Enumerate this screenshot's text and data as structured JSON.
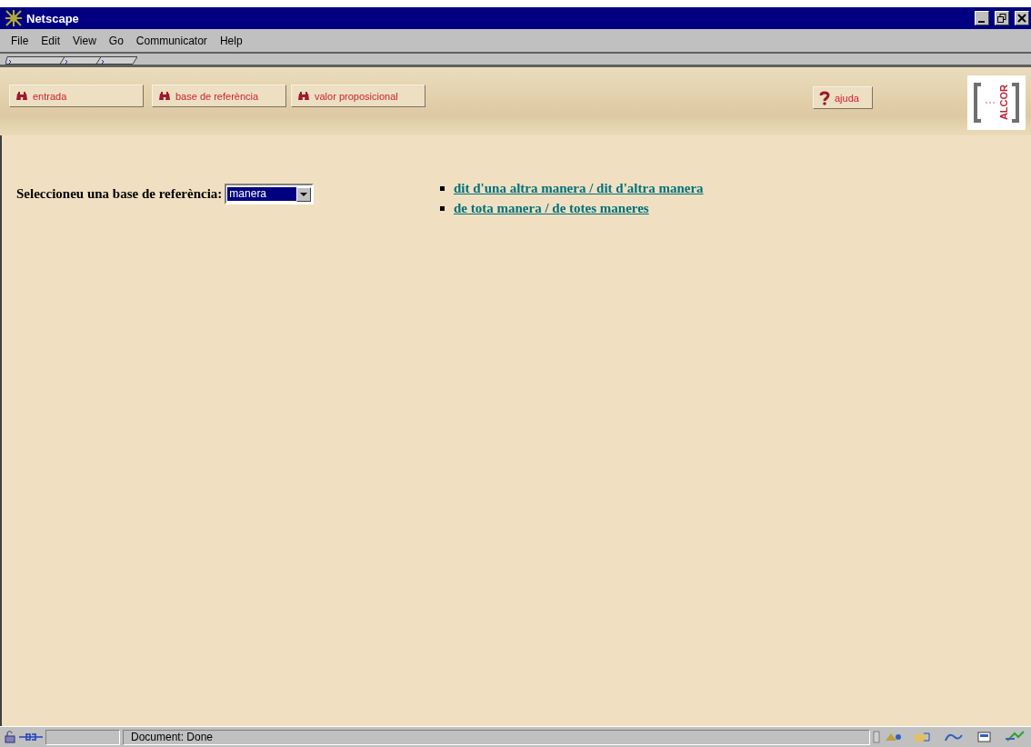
{
  "window": {
    "title": "Netscape"
  },
  "menu": [
    "File",
    "Edit",
    "View",
    "Go",
    "Communicator",
    "Help"
  ],
  "nav_buttons": [
    {
      "label": "entrada",
      "kind": "binoculars"
    },
    {
      "label": "base de referència",
      "kind": "binoculars"
    },
    {
      "label": "valor proposicional",
      "kind": "binoculars"
    },
    {
      "label": "ajuda",
      "kind": "help"
    }
  ],
  "logo": {
    "text": "ALCOR"
  },
  "form": {
    "label": "Seleccioneu una base de referència:",
    "select_value": "manera"
  },
  "links": [
    "dit d'una altra manera / dit d'altra manera",
    "de tota manera / de totes maneres"
  ],
  "status_bar": {
    "text": "Document: Done"
  }
}
